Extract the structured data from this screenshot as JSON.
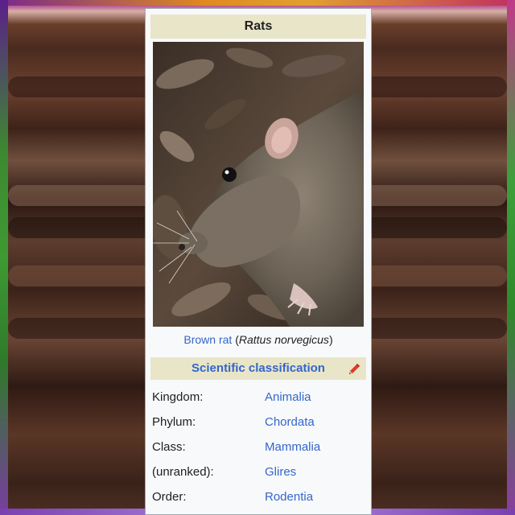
{
  "infobox": {
    "title": "Rats",
    "image_caption_common": "Brown rat",
    "image_caption_open": " (",
    "image_caption_scientific": "Rattus norvegicus",
    "image_caption_close": ")",
    "section_title": "Scientific classification",
    "edit_icon": "pencil-icon",
    "rows": [
      {
        "label": "Kingdom:",
        "value": "Animalia"
      },
      {
        "label": "Phylum:",
        "value": "Chordata"
      },
      {
        "label": "Class:",
        "value": "Mammalia"
      },
      {
        "label": "(unranked):",
        "value": "Glires"
      },
      {
        "label": "Order:",
        "value": "Rodentia"
      }
    ]
  },
  "colors": {
    "header_bg": "#e9e5c9",
    "link": "#3366cc",
    "box_bg": "#f8f9fa",
    "border": "#a2a9b1"
  }
}
